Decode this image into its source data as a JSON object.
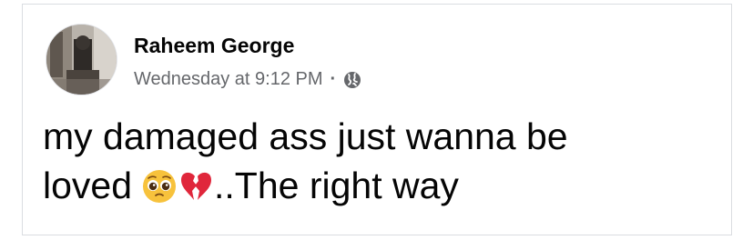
{
  "post": {
    "author": "Raheem George",
    "timestamp": "Wednesday at 9:12 PM",
    "separator": "·",
    "audience_icon": "globe-icon",
    "text_line1": "my damaged ass just wanna be",
    "text_line2_start": "loved",
    "emoji_1": "pleading-face",
    "emoji_2": "broken-heart",
    "text_line2_end": "..The right way"
  },
  "colors": {
    "text_primary": "#050505",
    "text_secondary": "#65676b",
    "card_border": "#dadde1",
    "emoji_yellow": "#f7c23c",
    "broken_heart": "#e0263b"
  }
}
